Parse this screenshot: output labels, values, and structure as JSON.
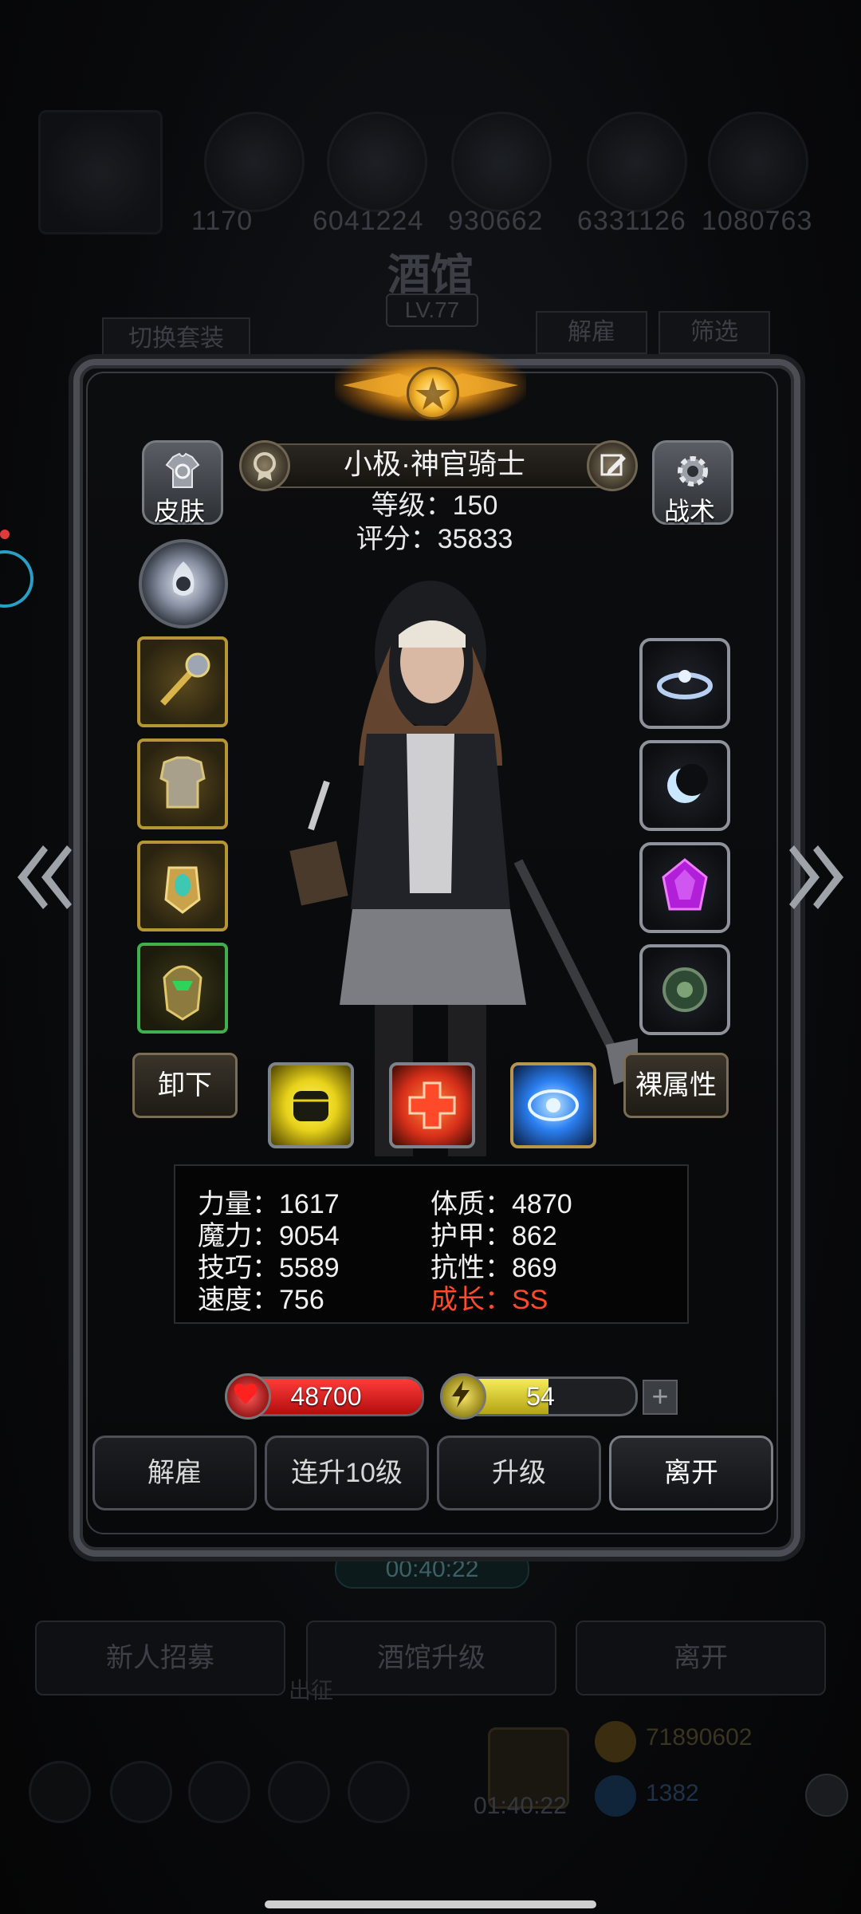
{
  "background": {
    "top_numbers": [
      "1170",
      "6041224",
      "930662",
      "6331126",
      "1080763"
    ],
    "title": "酒馆",
    "level": "LV.77",
    "switch_set": "切换套装",
    "dismiss": "解雇",
    "filter": "筛选",
    "timer": "00:40:22",
    "buttons": [
      "新人招募",
      "酒馆升级",
      "离开"
    ],
    "out": "出征",
    "bottom_timer": "01:40:22",
    "gold": "71890602",
    "gems": "1382"
  },
  "hero": {
    "name": "小极·神官骑士",
    "level_text": "等级：150",
    "score_text": "评分：35833",
    "skin_label": "皮肤",
    "tactics_label": "战术",
    "unequip_label": "卸下",
    "naked_attr_label": "裸属性"
  },
  "stats": {
    "strength": "力量：1617",
    "magic": "魔力：9054",
    "skill": "技巧：5589",
    "speed": "速度：756",
    "constitution": "体质：4870",
    "armor": "护甲：862",
    "resistance": "抗性：869",
    "growth": "成长：SS"
  },
  "bars": {
    "hp_value": "48700",
    "hp_fill": 1.0,
    "energy_value": "54",
    "energy_fill": 0.54,
    "plus": "+"
  },
  "actions": {
    "dismiss": "解雇",
    "level_up_10": "连升10级",
    "upgrade": "升级",
    "leave": "离开"
  },
  "icons": {
    "left_slots": [
      "mace-icon",
      "armor-icon",
      "amulet-icon",
      "helmet-icon"
    ],
    "right_slots": [
      "tiara-icon",
      "moon-ring-icon",
      "purple-gem-icon",
      "green-orb-icon"
    ],
    "skills": [
      "fist-skill-icon",
      "heal-cross-skill-icon",
      "eye-skill-icon"
    ]
  },
  "colors": {
    "growth": "#ff4b2b",
    "hp": "#e21b1b",
    "energy": "#e8dd3a",
    "gold_frame": "#b69537"
  }
}
